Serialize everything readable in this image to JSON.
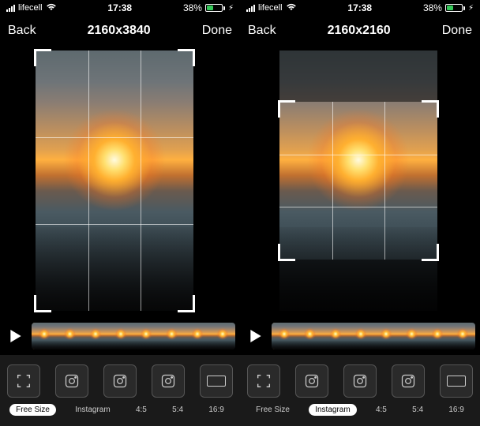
{
  "left": {
    "status": {
      "carrier": "lifecell",
      "time": "17:38",
      "battery_pct": "38%"
    },
    "nav": {
      "back": "Back",
      "title": "2160x3840",
      "done": "Done"
    },
    "aspects": [
      {
        "label": "Free Size",
        "selected": true
      },
      {
        "label": "Instagram",
        "selected": false
      },
      {
        "label": "4:5",
        "selected": false
      },
      {
        "label": "5:4",
        "selected": false
      },
      {
        "label": "16:9",
        "selected": false
      }
    ]
  },
  "right": {
    "status": {
      "carrier": "lifecell",
      "time": "17:38",
      "battery_pct": "38%"
    },
    "nav": {
      "back": "Back",
      "title": "2160x2160",
      "done": "Done"
    },
    "aspects": [
      {
        "label": "Free Size",
        "selected": false
      },
      {
        "label": "Instagram",
        "selected": true
      },
      {
        "label": "4:5",
        "selected": false
      },
      {
        "label": "5:4",
        "selected": false
      },
      {
        "label": "16:9",
        "selected": false
      }
    ]
  },
  "colors": {
    "accent": "#ff8c1a",
    "battery_fill": "#35c759"
  }
}
